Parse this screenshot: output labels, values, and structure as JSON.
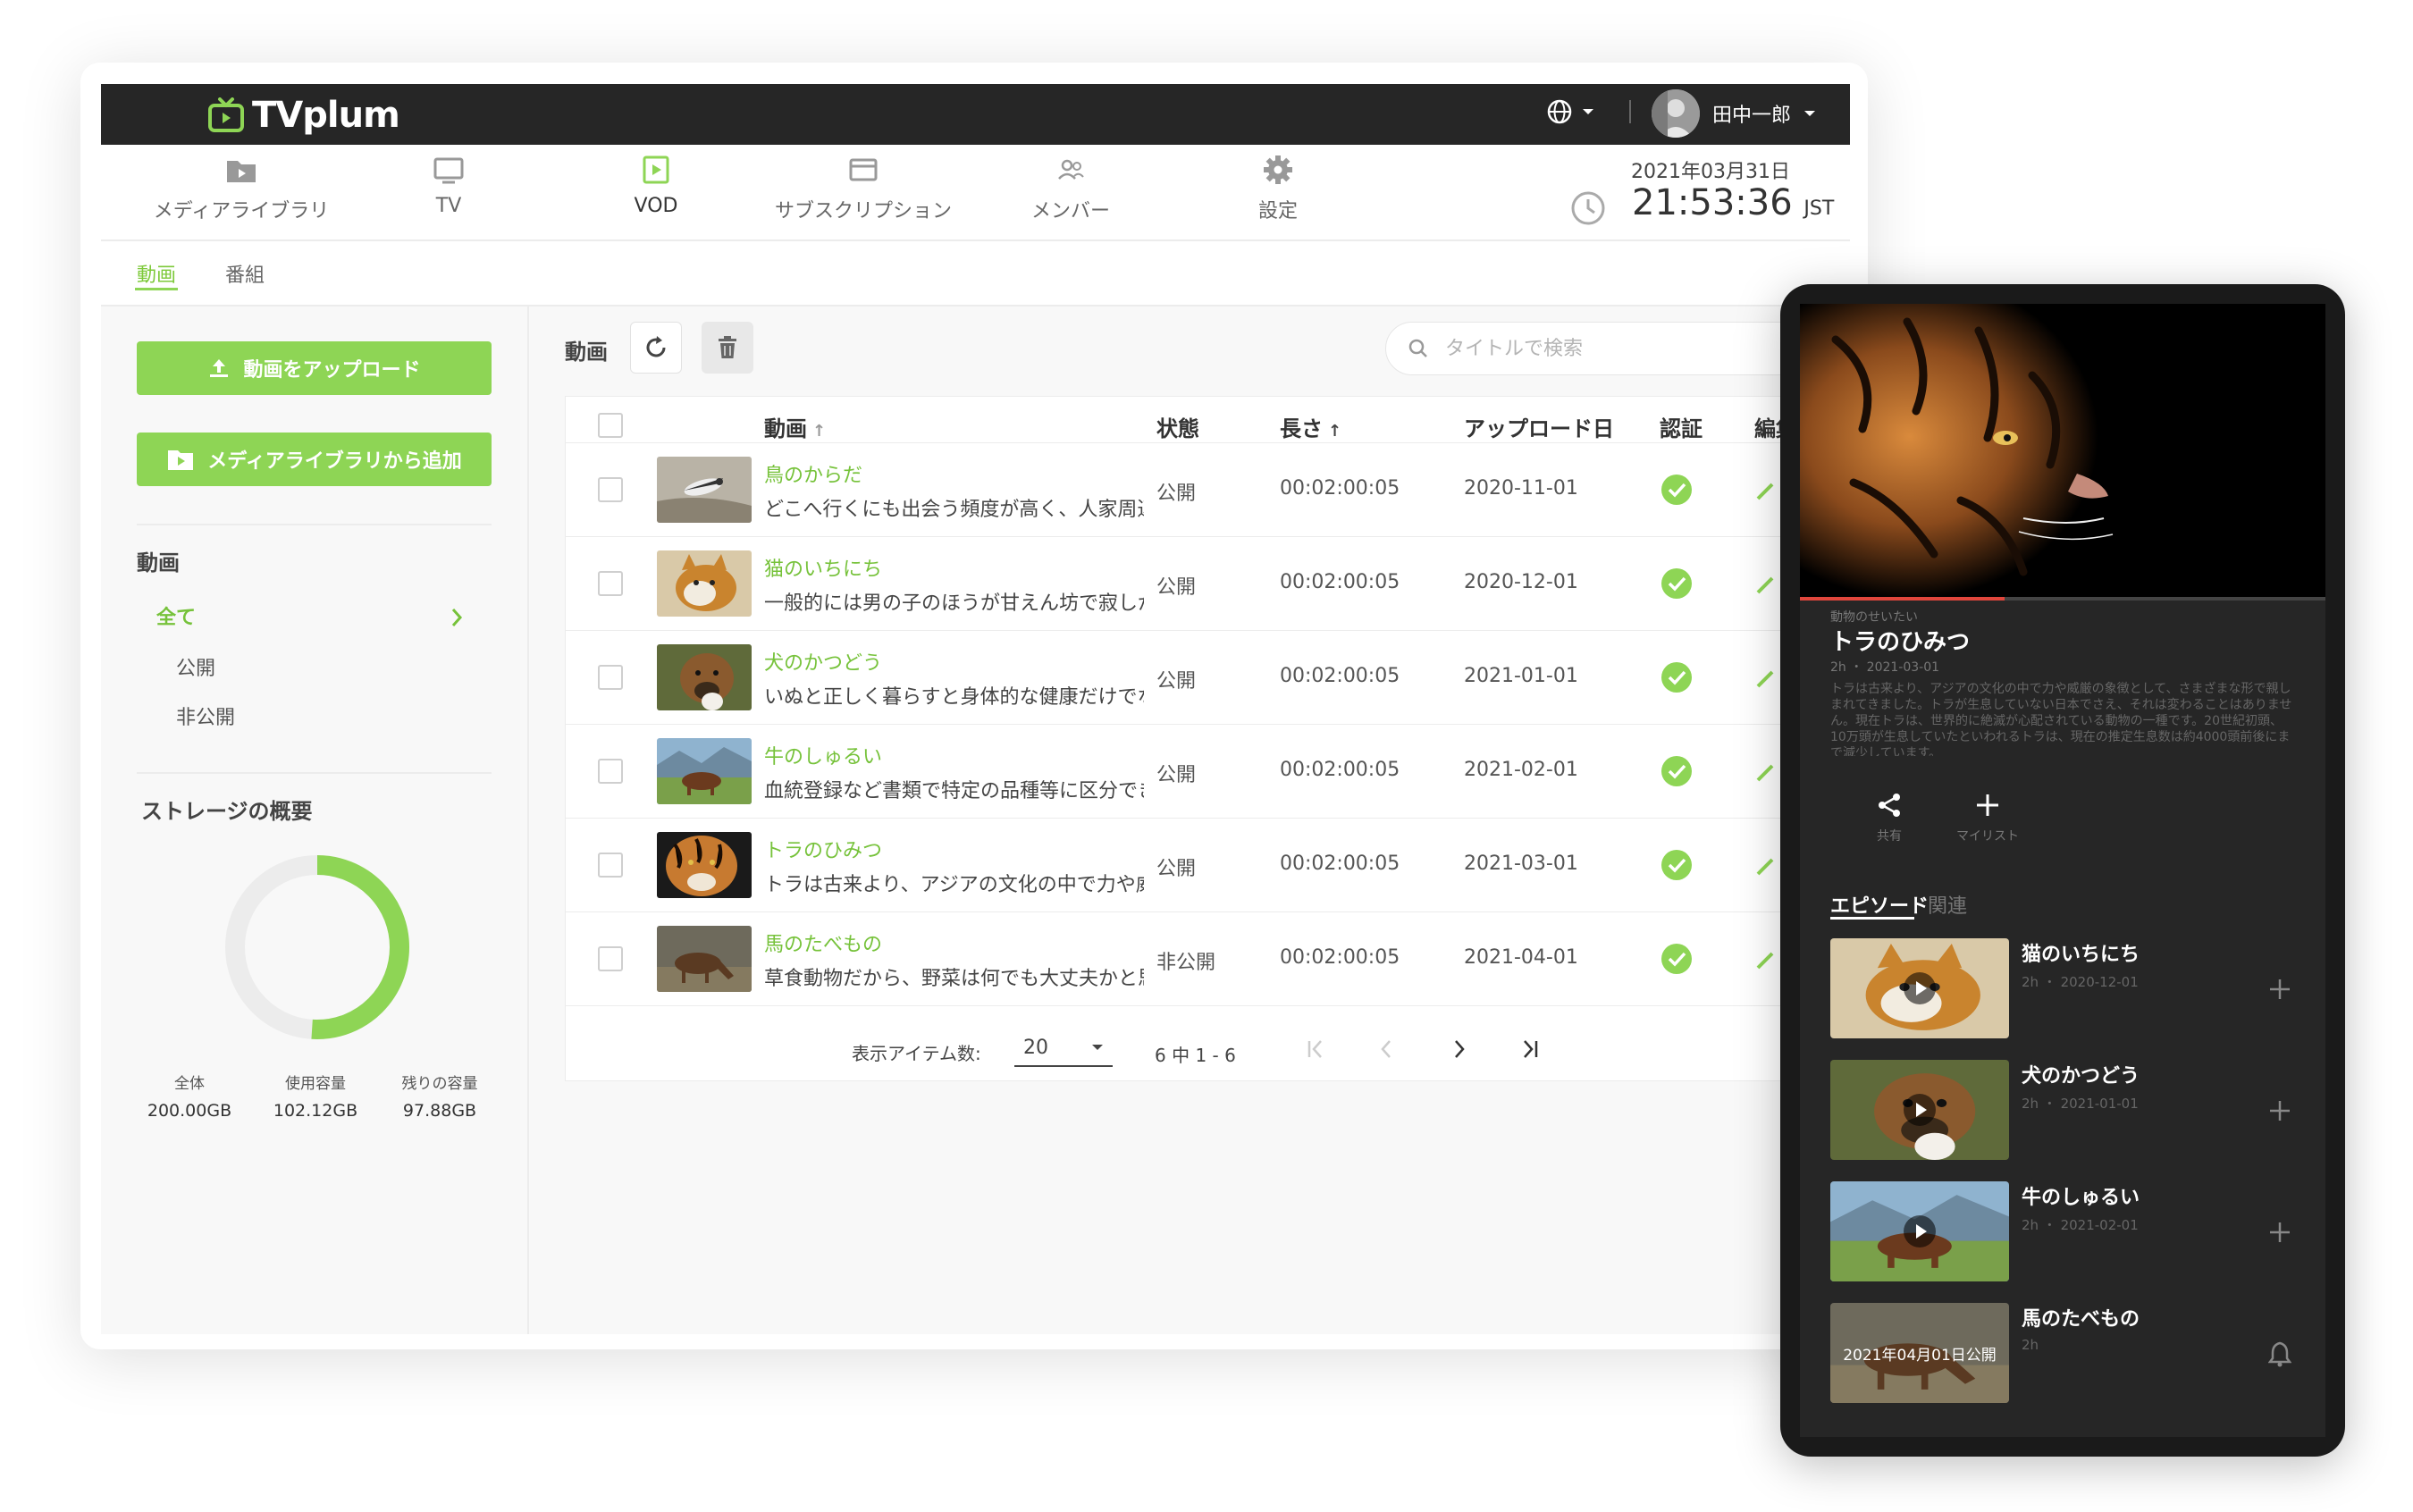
{
  "app": {
    "logo": "TVplum",
    "user_name": "田中一郎"
  },
  "nav": [
    {
      "label": "メディアライブラリ",
      "icon": "folder-play-icon"
    },
    {
      "label": "TV",
      "icon": "monitor-icon"
    },
    {
      "label": "VOD",
      "icon": "play-square-icon"
    },
    {
      "label": "サブスクリプション",
      "icon": "card-icon"
    },
    {
      "label": "メンバー",
      "icon": "members-icon"
    },
    {
      "label": "設定",
      "icon": "gear-icon"
    }
  ],
  "clock": {
    "date": "2021年03月31日",
    "time": "21:53:36",
    "tz": "JST"
  },
  "subtabs": [
    "動画",
    "番組"
  ],
  "sidebar": {
    "upload_label": "動画をアップロード",
    "add_from_library_label": "メディアライブラリから追加",
    "section_title": "動画",
    "filters": [
      "全て",
      "公開",
      "非公開"
    ],
    "storage_title": "ストレージの概要",
    "storage": [
      {
        "label": "全体",
        "value": "200.00GB"
      },
      {
        "label": "使用容量",
        "value": "102.12GB"
      },
      {
        "label": "残りの容量",
        "value": "97.88GB"
      }
    ],
    "storage_used_fraction": 0.51
  },
  "toolbar": {
    "title": "動画",
    "search_placeholder": "タイトルで検索"
  },
  "table": {
    "headers": {
      "video": "動画",
      "status": "状態",
      "length": "長さ",
      "uploaded": "アップロード日",
      "verified": "認証",
      "edit": "編集"
    },
    "rows": [
      {
        "title": "鳥のからだ",
        "desc": "どこへ行くにも出会う頻度が高く、人家周辺",
        "status": "公開",
        "length": "00:02:00:05",
        "date": "2020-11-01"
      },
      {
        "title": "猫のいちにち",
        "desc": "一般的には男の子のほうが甘えん坊で寂しが",
        "status": "公開",
        "length": "00:02:00:05",
        "date": "2020-12-01"
      },
      {
        "title": "犬のかつどう",
        "desc": "いぬと正しく暮らすと身体的な健康だけでな",
        "status": "公開",
        "length": "00:02:00:05",
        "date": "2021-01-01"
      },
      {
        "title": "牛のしゅるい",
        "desc": "血統登録など書類で特定の品種等に区分でき",
        "status": "公開",
        "length": "00:02:00:05",
        "date": "2021-02-01"
      },
      {
        "title": "トラのひみつ",
        "desc": "トラは古来より、アジアの文化の中で力や威",
        "status": "公開",
        "length": "00:02:00:05",
        "date": "2021-03-01"
      },
      {
        "title": "馬のたべもの",
        "desc": "草食動物だから、野菜は何でも大丈夫かと思",
        "status": "非公開",
        "length": "00:02:00:05",
        "date": "2021-04-01"
      }
    ],
    "per_page_label": "表示アイテム数:",
    "per_page": "20",
    "range_label": "6 中 1 - 6"
  },
  "tablet": {
    "category": "動物のせいたい",
    "title": "トラのひみつ",
    "meta": "2h ・ 2021-03-01",
    "description": "トラは古来より、アジアの文化の中で力や威厳の象徴として、さまざまな形で親しまれてきました。トラが生息していない日本でさえ、それは変わることはありません。現在トラは、世界的に絶滅が心配されている動物の一種です。20世紀初頭、10万頭が生息していたといわれるトラは、現在の推定生息数は約4000頭前後にまで減少しています。",
    "share_label": "共有",
    "mylist_label": "マイリスト",
    "tabs": [
      "エピソード",
      "関連"
    ],
    "episodes": [
      {
        "title": "猫のいちにち",
        "meta": "2h ・ 2020-12-01"
      },
      {
        "title": "犬のかつどう",
        "meta": "2h ・ 2021-01-01"
      },
      {
        "title": "牛のしゅるい",
        "meta": "2h ・ 2021-02-01"
      },
      {
        "title": "馬のたべもの",
        "meta": "2h",
        "overlay": "2021年04月01日公開"
      }
    ],
    "progress_fraction": 0.39
  },
  "colors": {
    "accent": "#8ed555",
    "accent_text": "#76c23a",
    "topbar": "#262626",
    "tablet_bg": "#262626",
    "progress": "#e0463c"
  }
}
